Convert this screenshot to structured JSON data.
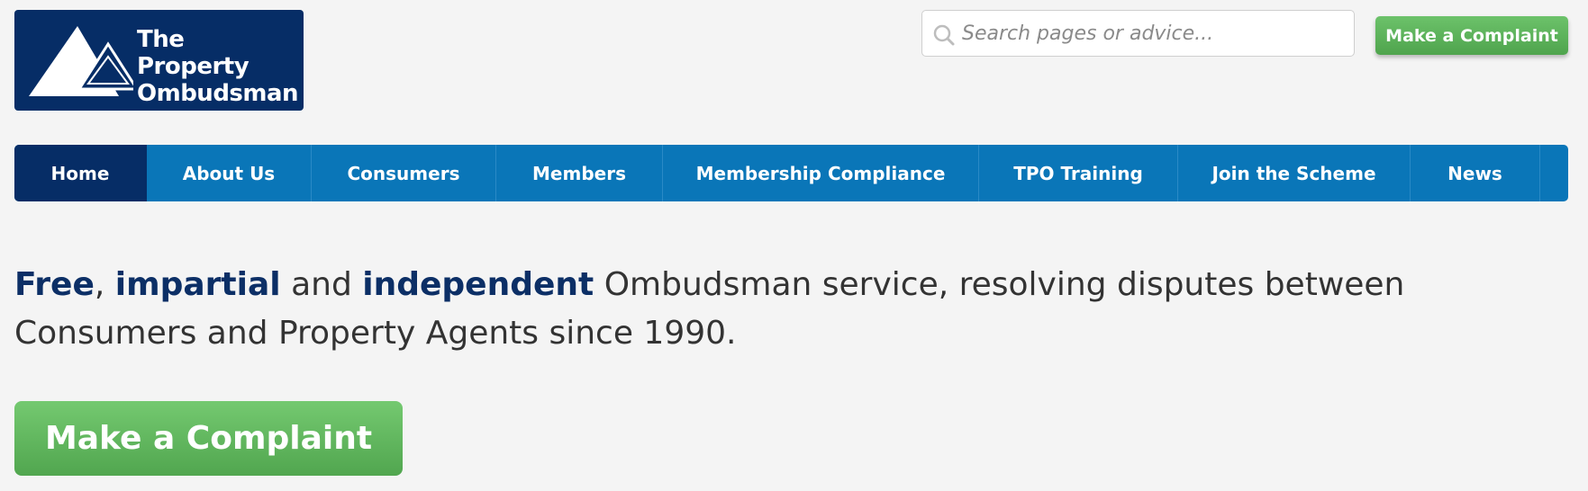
{
  "logo": {
    "line1": "The Property",
    "line2": "Ombudsman",
    "colors": {
      "background": "#062d66"
    }
  },
  "search": {
    "placeholder": "Search pages or advice...",
    "value": "",
    "icon": "search-icon"
  },
  "header": {
    "complaint_label": "Make a Complaint"
  },
  "nav": {
    "items": [
      {
        "label": "Home",
        "active": true
      },
      {
        "label": "About Us"
      },
      {
        "label": "Consumers"
      },
      {
        "label": "Members"
      },
      {
        "label": "Membership Compliance"
      },
      {
        "label": "TPO Training"
      },
      {
        "label": "Join the Scheme"
      },
      {
        "label": "News"
      }
    ]
  },
  "intro": {
    "free": "Free",
    "comma": ", ",
    "impartial": "impartial",
    "and": " and ",
    "independent": "independent",
    "rest": " Ombudsman service, resolving disputes between Consumers and Property Agents since 1990."
  },
  "cta": {
    "complaint_label": "Make a Complaint"
  },
  "colors": {
    "nav_blue": "#0a76b8",
    "navy": "#062d66",
    "green": "#5cb85c",
    "page_bg": "#f4f4f4"
  }
}
